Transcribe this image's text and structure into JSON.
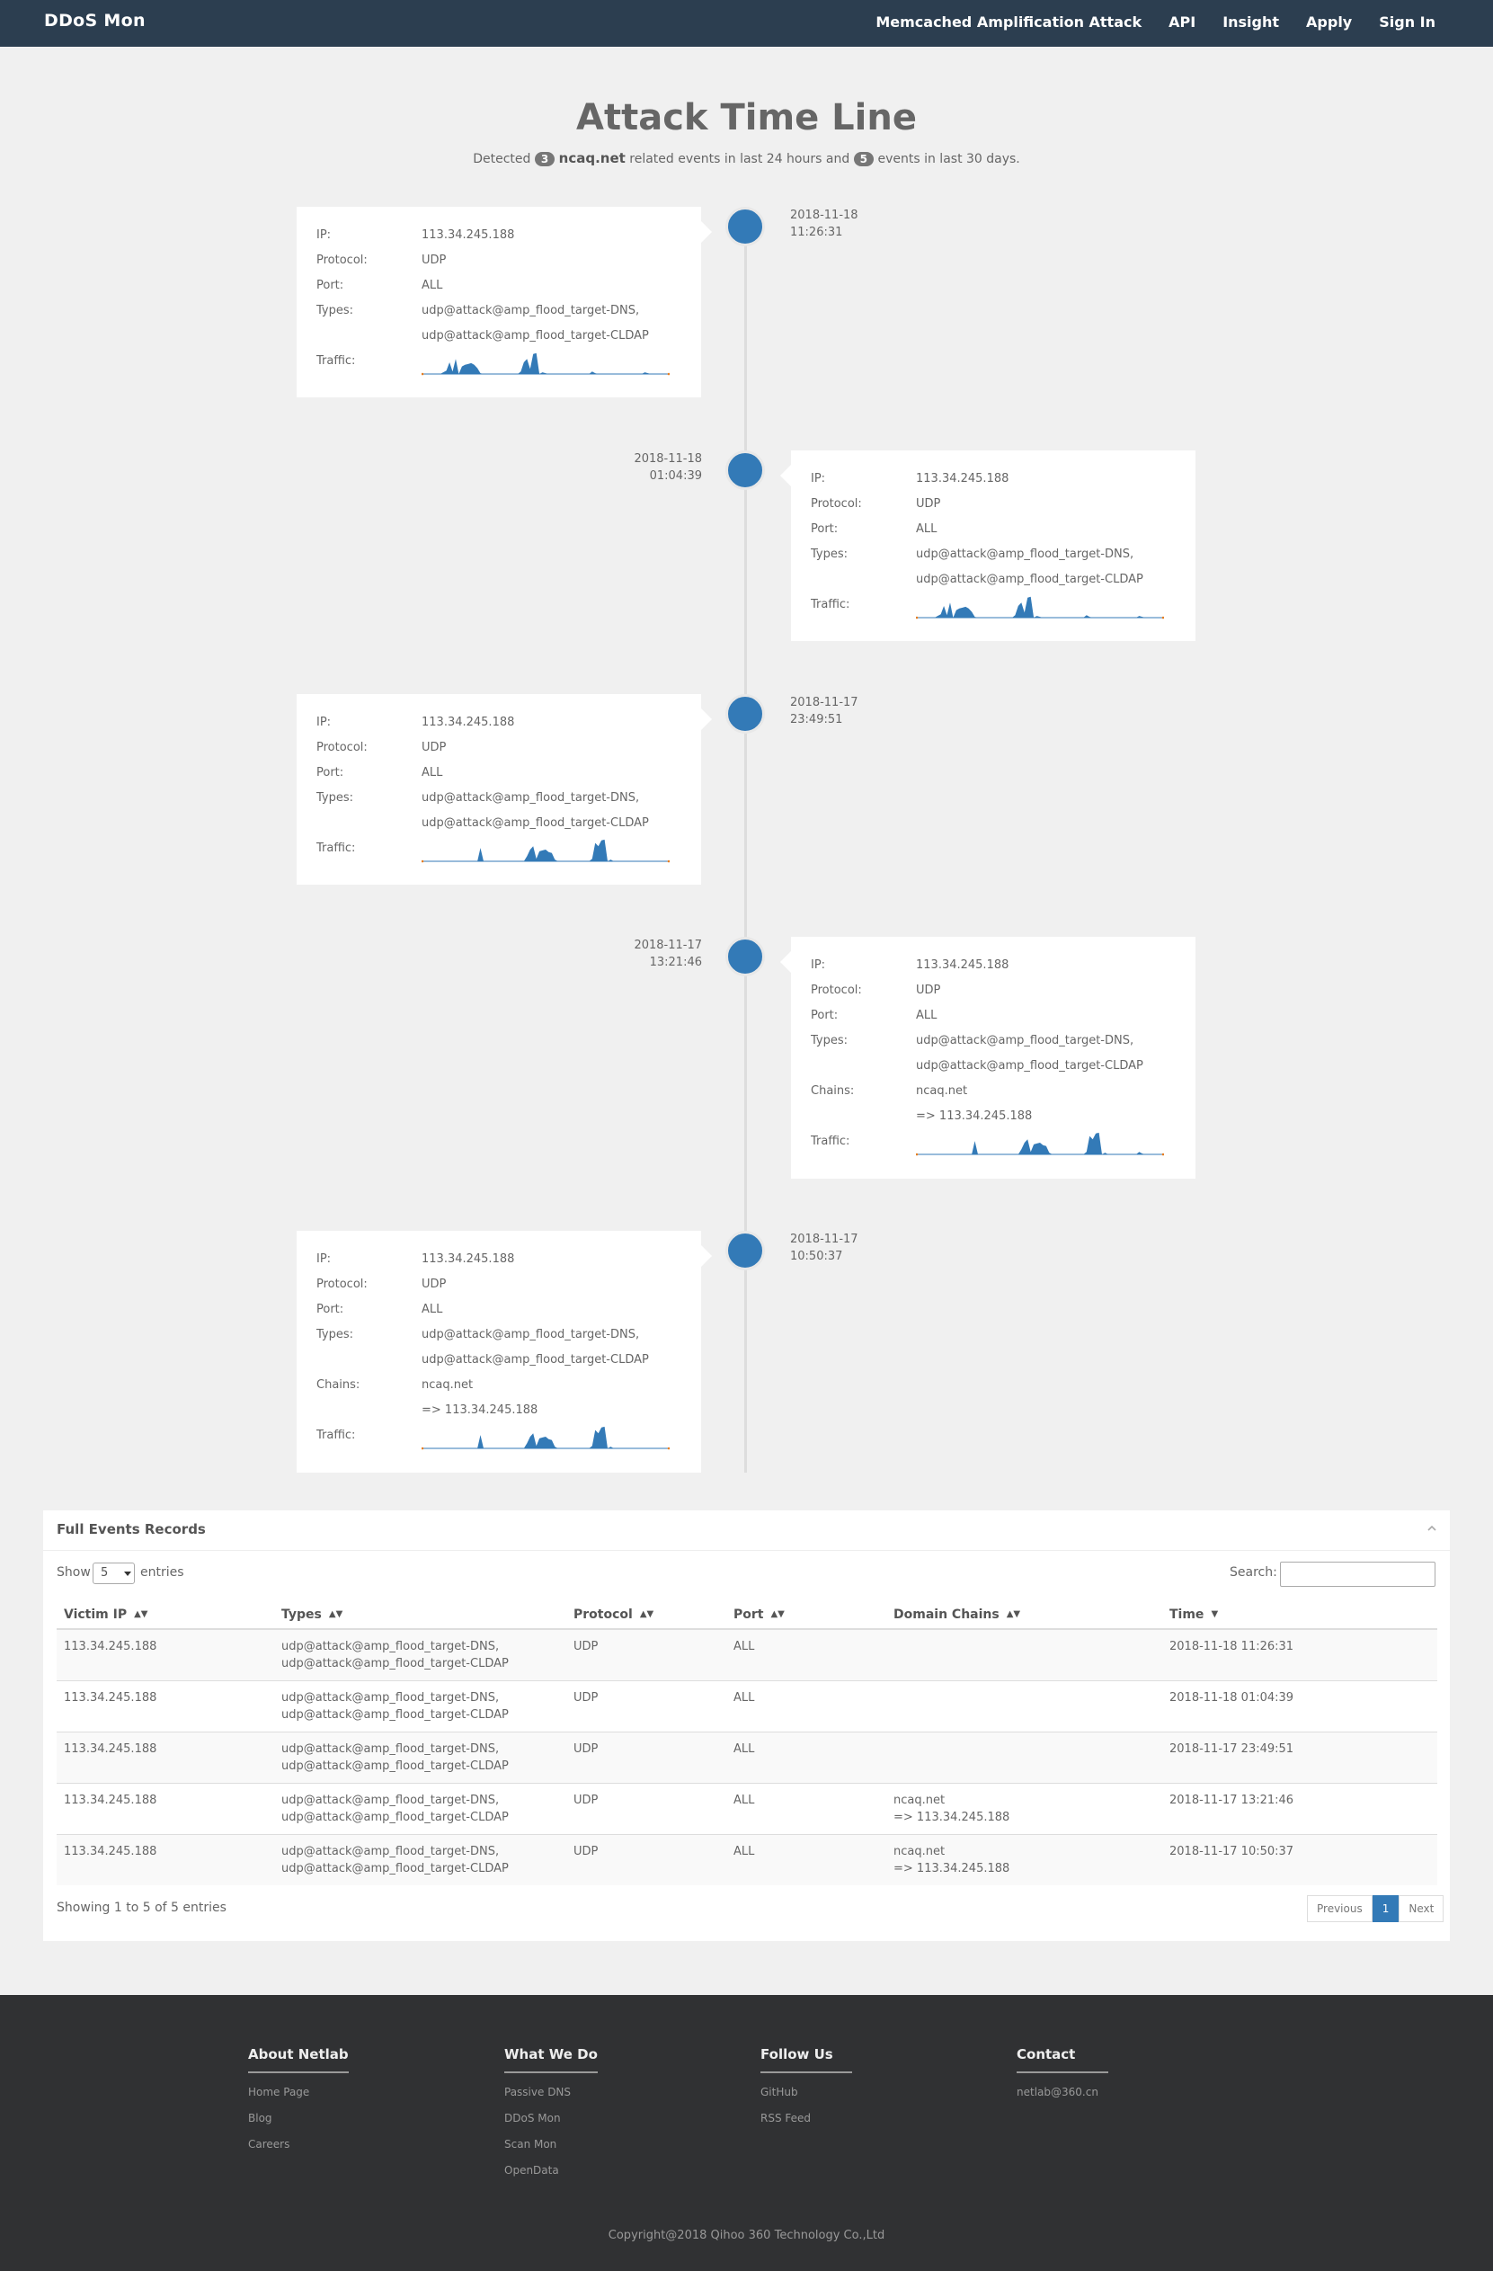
{
  "navbar": {
    "brand": "DDoS Mon",
    "links": [
      "Memcached Amplification Attack",
      "API",
      "Insight",
      "Apply",
      "Sign In"
    ]
  },
  "header": {
    "title": "Attack Time Line",
    "detected_prefix": "Detected",
    "count_24h": "3",
    "domain": "ncaq.net",
    "mid_text": "related events in last 24 hours and",
    "count_30d": "5",
    "suffix_text": "events in last 30 days."
  },
  "labels": {
    "ip": "IP:",
    "protocol": "Protocol:",
    "port": "Port:",
    "types": "Types:",
    "chains": "Chains:",
    "traffic": "Traffic:"
  },
  "timeline": [
    {
      "date": "2018-11-18",
      "time": "11:26:31",
      "ip": "113.34.245.188",
      "protocol": "UDP",
      "port": "ALL",
      "type1": "udp@attack@amp_flood_target-DNS,",
      "type2": "udp@attack@amp_flood_target-CLDAP",
      "chain1": "",
      "chain2": "",
      "traffic": [
        0,
        0,
        0,
        0,
        0,
        0,
        0,
        2,
        4,
        14,
        3,
        18,
        0,
        9,
        11,
        12,
        13,
        11,
        7,
        1,
        0,
        0,
        0,
        0,
        0,
        0,
        0,
        0,
        0,
        0,
        0,
        0,
        3,
        14,
        18,
        6,
        24,
        25,
        0,
        2,
        1,
        0,
        0,
        0,
        0,
        0,
        0,
        0,
        0,
        0,
        0,
        0,
        0,
        0,
        0,
        3,
        1,
        0,
        0,
        0,
        0,
        0,
        0,
        0,
        0,
        0,
        0,
        0,
        0,
        0,
        0,
        0,
        2,
        1,
        0,
        0,
        0,
        0,
        0,
        0,
        0
      ]
    },
    {
      "date": "2018-11-18",
      "time": "01:04:39",
      "ip": "113.34.245.188",
      "protocol": "UDP",
      "port": "ALL",
      "type1": "udp@attack@amp_flood_target-DNS,",
      "type2": "udp@attack@amp_flood_target-CLDAP",
      "chain1": "",
      "chain2": "",
      "traffic": [
        0,
        0,
        0,
        0,
        0,
        0,
        0,
        2,
        4,
        14,
        3,
        18,
        0,
        9,
        11,
        12,
        13,
        11,
        7,
        1,
        0,
        0,
        0,
        0,
        0,
        0,
        0,
        0,
        0,
        0,
        0,
        0,
        3,
        14,
        18,
        6,
        24,
        25,
        0,
        2,
        1,
        0,
        0,
        0,
        0,
        0,
        0,
        0,
        0,
        0,
        0,
        0,
        0,
        0,
        0,
        3,
        1,
        0,
        0,
        0,
        0,
        0,
        0,
        0,
        0,
        0,
        0,
        0,
        0,
        0,
        0,
        0,
        2,
        1,
        0,
        0,
        0,
        0,
        0,
        0,
        0
      ]
    },
    {
      "date": "2018-11-17",
      "time": "23:49:51",
      "ip": "113.34.245.188",
      "protocol": "UDP",
      "port": "ALL",
      "type1": "udp@attack@amp_flood_target-DNS,",
      "type2": "udp@attack@amp_flood_target-CLDAP",
      "chain1": "",
      "chain2": "",
      "traffic": [
        0,
        0,
        0,
        0,
        0,
        0,
        0,
        0,
        0,
        0,
        0,
        0,
        0,
        0,
        0,
        0,
        0,
        0,
        0,
        16,
        0,
        0,
        0,
        0,
        0,
        0,
        0,
        0,
        0,
        0,
        0,
        0,
        0,
        0,
        6,
        14,
        18,
        3,
        12,
        13,
        14,
        11,
        10,
        2,
        0,
        0,
        0,
        0,
        0,
        0,
        0,
        0,
        0,
        0,
        0,
        3,
        22,
        18,
        25,
        26,
        0,
        2,
        0,
        0,
        0,
        0,
        0,
        0,
        0,
        0,
        0,
        0,
        0,
        0,
        0,
        0,
        0,
        0,
        0,
        0,
        0
      ]
    },
    {
      "date": "2018-11-17",
      "time": "13:21:46",
      "ip": "113.34.245.188",
      "protocol": "UDP",
      "port": "ALL",
      "type1": "udp@attack@amp_flood_target-DNS,",
      "type2": "udp@attack@amp_flood_target-CLDAP",
      "chain1": "ncaq.net",
      "chain2": "=> 113.34.245.188",
      "traffic": [
        0,
        0,
        0,
        0,
        0,
        0,
        0,
        0,
        0,
        0,
        0,
        0,
        0,
        0,
        0,
        0,
        0,
        0,
        0,
        16,
        0,
        0,
        0,
        0,
        0,
        0,
        0,
        0,
        0,
        0,
        0,
        0,
        0,
        0,
        6,
        14,
        18,
        3,
        12,
        13,
        14,
        11,
        10,
        2,
        0,
        0,
        0,
        0,
        0,
        0,
        0,
        0,
        0,
        0,
        0,
        3,
        22,
        18,
        25,
        26,
        0,
        2,
        0,
        0,
        0,
        0,
        0,
        0,
        0,
        0,
        0,
        0,
        3,
        1,
        0,
        0,
        0,
        0,
        0,
        0,
        0
      ]
    },
    {
      "date": "2018-11-17",
      "time": "10:50:37",
      "ip": "113.34.245.188",
      "protocol": "UDP",
      "port": "ALL",
      "type1": "udp@attack@amp_flood_target-DNS,",
      "type2": "udp@attack@amp_flood_target-CLDAP",
      "chain1": "ncaq.net",
      "chain2": "=> 113.34.245.188",
      "traffic": [
        0,
        0,
        0,
        0,
        0,
        0,
        0,
        0,
        0,
        0,
        0,
        0,
        0,
        0,
        0,
        0,
        0,
        0,
        0,
        16,
        0,
        0,
        0,
        0,
        0,
        0,
        0,
        0,
        0,
        0,
        0,
        0,
        0,
        0,
        6,
        14,
        18,
        3,
        12,
        13,
        14,
        11,
        10,
        2,
        0,
        0,
        0,
        0,
        0,
        0,
        0,
        0,
        0,
        0,
        0,
        3,
        22,
        18,
        25,
        26,
        0,
        2,
        0,
        0,
        0,
        0,
        0,
        0,
        0,
        0,
        0,
        0,
        0,
        0,
        0,
        0,
        0,
        0,
        0,
        0,
        0
      ]
    }
  ],
  "records": {
    "title": "Full Events Records",
    "show_label": "Show",
    "show_value": "5",
    "entries_label": "entries",
    "search_label": "Search:",
    "columns": [
      "Victim IP",
      "Types",
      "Protocol",
      "Port",
      "Domain Chains",
      "Time"
    ],
    "rows": [
      {
        "ip": "113.34.245.188",
        "type1": "udp@attack@amp_flood_target-DNS,",
        "type2": "udp@attack@amp_flood_target-CLDAP",
        "protocol": "UDP",
        "port": "ALL",
        "chain1": "",
        "chain2": "",
        "time": "2018-11-18 11:26:31"
      },
      {
        "ip": "113.34.245.188",
        "type1": "udp@attack@amp_flood_target-DNS,",
        "type2": "udp@attack@amp_flood_target-CLDAP",
        "protocol": "UDP",
        "port": "ALL",
        "chain1": "",
        "chain2": "",
        "time": "2018-11-18 01:04:39"
      },
      {
        "ip": "113.34.245.188",
        "type1": "udp@attack@amp_flood_target-DNS,",
        "type2": "udp@attack@amp_flood_target-CLDAP",
        "protocol": "UDP",
        "port": "ALL",
        "chain1": "",
        "chain2": "",
        "time": "2018-11-17 23:49:51"
      },
      {
        "ip": "113.34.245.188",
        "type1": "udp@attack@amp_flood_target-DNS,",
        "type2": "udp@attack@amp_flood_target-CLDAP",
        "protocol": "UDP",
        "port": "ALL",
        "chain1": "ncaq.net",
        "chain2": "=> 113.34.245.188",
        "time": "2018-11-17 13:21:46"
      },
      {
        "ip": "113.34.245.188",
        "type1": "udp@attack@amp_flood_target-DNS,",
        "type2": "udp@attack@amp_flood_target-CLDAP",
        "protocol": "UDP",
        "port": "ALL",
        "chain1": "ncaq.net",
        "chain2": "=> 113.34.245.188",
        "time": "2018-11-17 10:50:37"
      }
    ],
    "info": "Showing 1 to 5 of 5 entries",
    "pager": {
      "previous": "Previous",
      "current": "1",
      "next": "Next"
    }
  },
  "footer": {
    "columns": [
      {
        "title": "About Netlab",
        "items": [
          "Home Page",
          "Blog",
          "Careers"
        ]
      },
      {
        "title": "What We Do",
        "items": [
          "Passive DNS",
          "DDoS Mon",
          "Scan Mon",
          "OpenData"
        ]
      },
      {
        "title": "Follow Us",
        "items": [
          "GitHub",
          "RSS Feed"
        ]
      },
      {
        "title": "Contact",
        "items": [
          "netlab@360.cn"
        ]
      }
    ],
    "copyright": "Copyright@2018 Qihoo 360 Technology Co.,Ltd"
  },
  "colors": {
    "accent": "#337ab7",
    "navbar": "#2c3e50",
    "footer": "#303133",
    "spark_fill": "#337ab7",
    "spark_end": "#e67e22"
  }
}
